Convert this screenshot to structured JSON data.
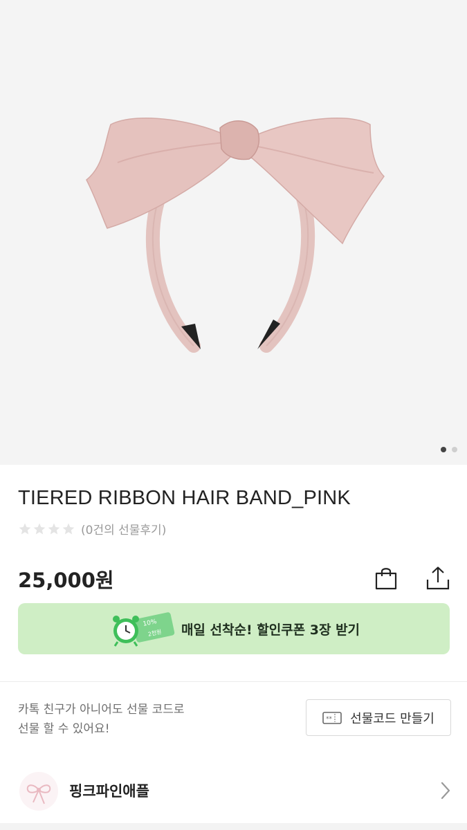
{
  "product": {
    "title": "TIERED RIBBON HAIR BAND_PINK",
    "review_text": "(0건의 선물후기)",
    "rating": 0,
    "rating_max": 4,
    "price": "25,000원",
    "image_pages": 2,
    "image_current": 1
  },
  "coupon": {
    "text": "매일 선착순! 할인쿠폰 3장 받기",
    "badge_percent": "10%",
    "badge_amount": "2천원"
  },
  "gift": {
    "desc_line1": "카톡 친구가 아니어도 선물 코드로",
    "desc_line2": "선물 할 수 있어요!",
    "button_label": "선물코드 만들기"
  },
  "brand": {
    "name": "핑크파인애플"
  },
  "colors": {
    "coupon_bg": "#cfeec5",
    "ribbon": "#e7c4c0",
    "star": "#e6e6e6"
  },
  "icons": [
    "shopping-bag-icon",
    "share-icon",
    "alarm-clock-icon",
    "ticket-icon",
    "chevron-right-icon"
  ]
}
